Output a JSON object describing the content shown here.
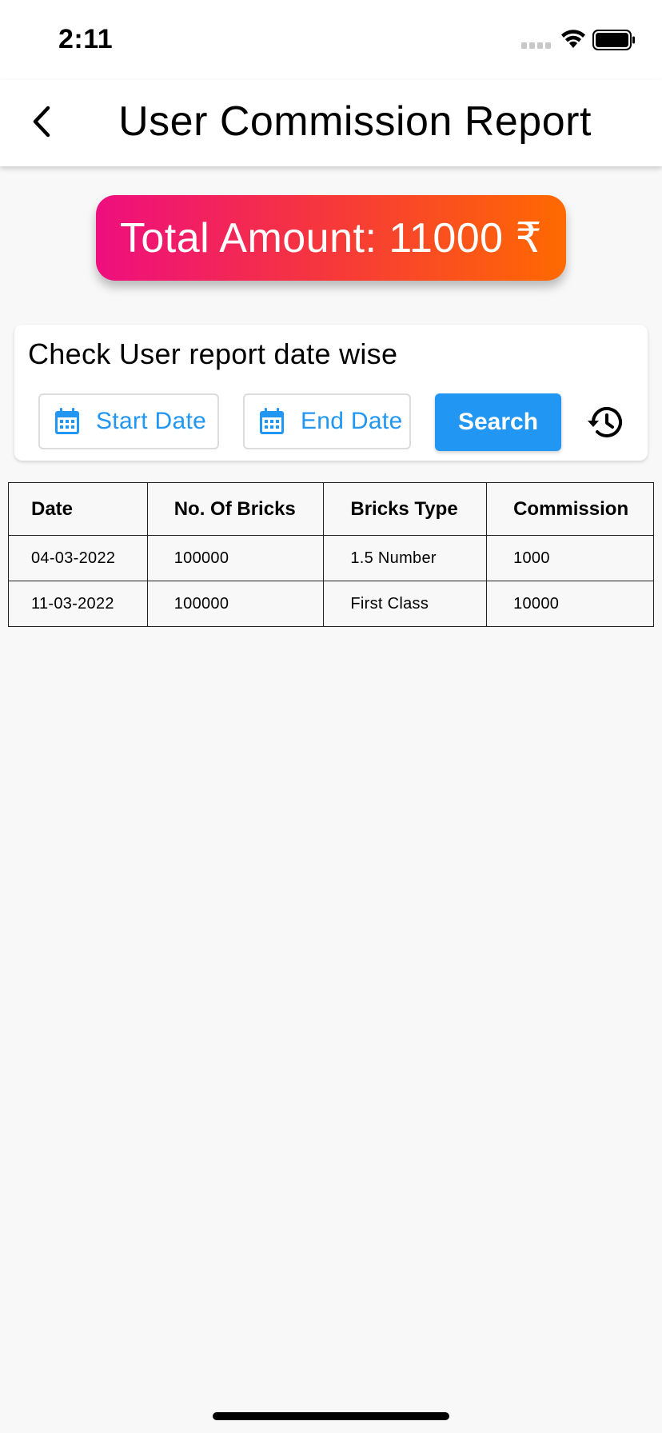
{
  "status_bar": {
    "time": "2:11",
    "icons": [
      "cellular-signal-icon",
      "wifi-icon",
      "battery-icon"
    ]
  },
  "app_bar": {
    "back_icon": "chevron-left-icon",
    "title": "User Commission Report"
  },
  "summary": {
    "total_label": "Total Amount: 11000 ₹",
    "gradient_colors": [
      "#ee0e7f",
      "#ff6a00"
    ]
  },
  "filter": {
    "title": "Check User report date wise",
    "start_date_label": "Start Date",
    "end_date_label": "End Date",
    "search_label": "Search",
    "date_icon": "calendar-icon",
    "history_icon": "history-icon",
    "accent_color": "#2196f3"
  },
  "table": {
    "headers": [
      "Date",
      "No. Of Bricks",
      "Bricks Type",
      "Commission"
    ],
    "rows": [
      [
        "04-03-2022",
        "100000",
        "1.5 Number",
        "1000"
      ],
      [
        "11-03-2022",
        "100000",
        "First Class",
        "10000"
      ]
    ]
  }
}
